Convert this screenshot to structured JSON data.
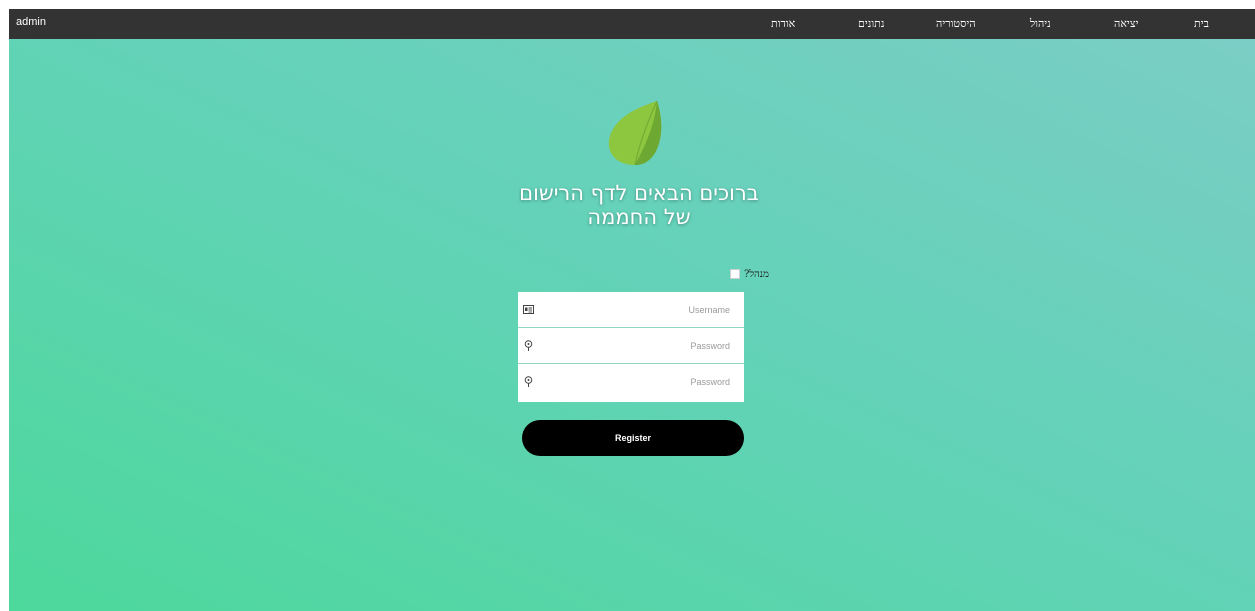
{
  "navbar": {
    "user": "admin",
    "items": [
      {
        "label": "בית"
      },
      {
        "label": "יציאה"
      },
      {
        "label": "ניהול"
      },
      {
        "label": "היסטוריה"
      },
      {
        "label": "נתונים"
      },
      {
        "label": "אודות"
      }
    ]
  },
  "welcome": {
    "line1": "ברוכים הבאים לדף הרישום",
    "line2": "של החממה"
  },
  "admin_checkbox": {
    "label": "מנהל?",
    "checked": false
  },
  "form": {
    "username_placeholder": "Username",
    "password_placeholder": "Password",
    "confirm_placeholder": "Password",
    "register_label": "Register"
  },
  "colors": {
    "navbar_bg": "#333333",
    "gradient_top": "#7ccdc5",
    "gradient_bottom": "#4dd89c",
    "leaf_light": "#8dc63f",
    "leaf_dark": "#6da832",
    "button_bg": "#000000"
  },
  "icons": {
    "logo": "leaf-icon",
    "username": "id-card-icon",
    "password": "key-icon",
    "confirm": "key-icon"
  }
}
